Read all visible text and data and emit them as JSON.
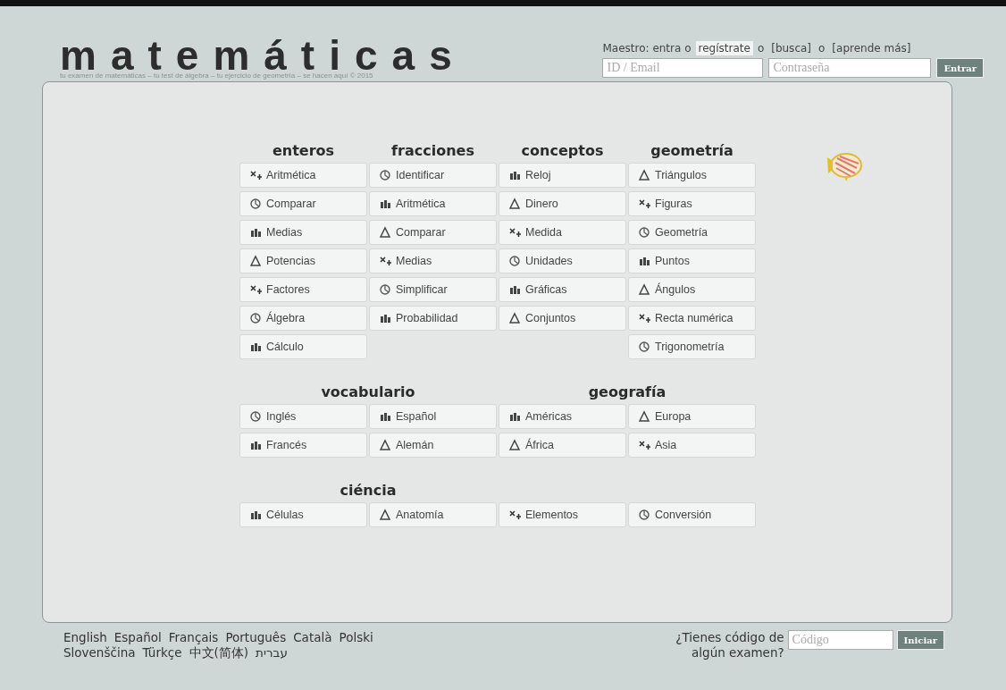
{
  "header": {
    "title": "matemáticas",
    "tagline": "tu examen de matemáticas – tu test de álgebra – tu ejercicio de geometría – se hacen aquí © 2015",
    "login_prompt": [
      {
        "kind": "text",
        "text": "Maestro: entra o"
      },
      {
        "kind": "link",
        "text": "regístrate",
        "selected": true
      },
      {
        "kind": "text",
        "text": "o"
      },
      {
        "kind": "link",
        "text": "[busca]",
        "selected": false
      },
      {
        "kind": "text",
        "text": "o"
      },
      {
        "kind": "link",
        "text": "[aprende más]",
        "selected": false
      }
    ],
    "id_field": {
      "placeholder": "ID / Email"
    },
    "password_field": {
      "placeholder": "Contraseña"
    },
    "login_button": "Entrar"
  },
  "groups": [
    {
      "sections": [
        {
          "title": "enteros",
          "columns": [
            [
              "Aritmética",
              "Comparar",
              "Medias",
              "Potencias",
              "Factores",
              "Álgebra",
              "Cálculo"
            ]
          ]
        },
        {
          "title": "fracciones",
          "columns": [
            [
              "Identificar",
              "Aritmética",
              "Comparar",
              "Medias",
              "Simplificar",
              "Probabilidad"
            ]
          ]
        },
        {
          "title": "conceptos",
          "columns": [
            [
              "Reloj",
              "Dinero",
              "Medida",
              "Unidades",
              "Gráficas",
              "Conjuntos"
            ]
          ]
        },
        {
          "title": "geometría",
          "columns": [
            [
              "Triángulos",
              "Figuras",
              "Geometría",
              "Puntos",
              "Ángulos",
              "Recta numérica",
              "Trigonometría"
            ]
          ]
        }
      ]
    },
    {
      "sections": [
        {
          "title": "vocabulario",
          "columns": [
            [
              "Inglés",
              "Francés"
            ],
            [
              "Español",
              "Alemán"
            ]
          ]
        },
        {
          "title": "geografía",
          "columns": [
            [
              "Américas",
              "África"
            ],
            [
              "Europa",
              "Asia"
            ]
          ]
        }
      ]
    },
    {
      "sections": [
        {
          "title": "ciéncia",
          "columns": [
            [
              "Células"
            ],
            [
              "Anatomía"
            ],
            [
              "Elementos"
            ],
            [
              "Conversión"
            ]
          ]
        }
      ]
    }
  ],
  "footer": {
    "languages": [
      [
        "English",
        "Español",
        "Français",
        "Português",
        "Català",
        "Polski"
      ],
      [
        "Slovenščina",
        "Türkçe",
        "中文(简体)",
        "עברית"
      ]
    ],
    "code_prompt": "¿Tienes código de algún examen?",
    "code_field": {
      "placeholder": "Código"
    },
    "code_button": "Iniciar"
  }
}
